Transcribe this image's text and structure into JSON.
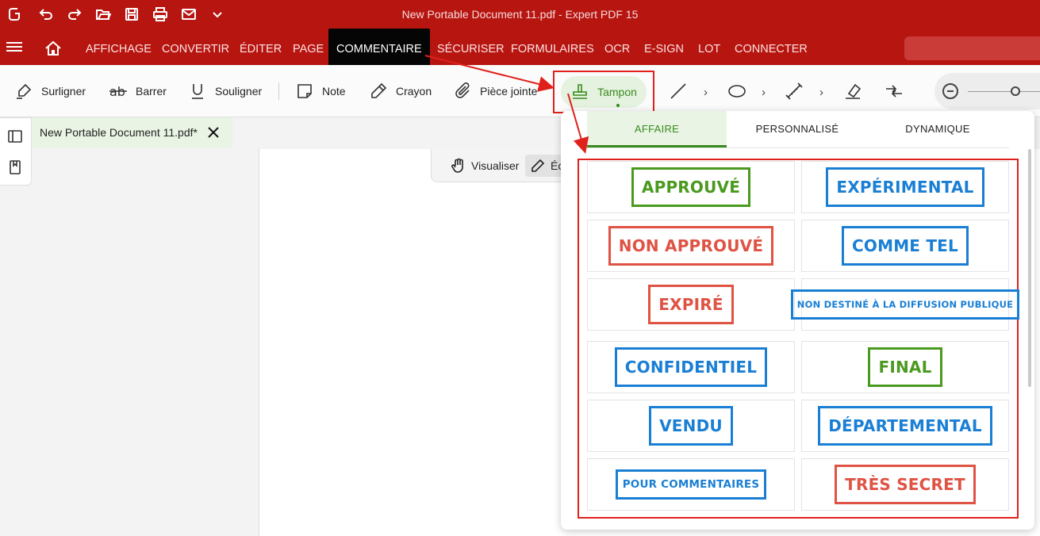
{
  "window": {
    "title": "New Portable Document 11.pdf   -   Expert PDF 15"
  },
  "quick_access": [
    "app-logo",
    "undo-icon",
    "redo-icon",
    "open-folder-icon",
    "save-icon",
    "print-icon",
    "mail-icon",
    "chevron-down-icon"
  ],
  "menu": {
    "items": [
      "AFFICHAGE",
      "CONVERTIR",
      "ÉDITER",
      "PAGE",
      "COMMENTAIRE",
      "SÉCURISER",
      "FORMULAIRES",
      "OCR",
      "E-SIGN",
      "LOT",
      "CONNECTER"
    ],
    "active": "COMMENTAIRE"
  },
  "toolbar": {
    "surligner": "Surligner",
    "barrer": "Barrer",
    "souligner": "Souligner",
    "note": "Note",
    "crayon": "Crayon",
    "piece_jointe": "Pièce jointe",
    "tampon": "Tampon"
  },
  "document_tab": {
    "name": "New Portable Document 11.pdf*"
  },
  "view_bar": {
    "visualiser": "Visualiser",
    "edit_partial": "Éc"
  },
  "stamp_panel": {
    "tabs": [
      "AFFAIRE",
      "PERSONNALISÉ",
      "DYNAMIQUE"
    ],
    "active_tab": "AFFAIRE",
    "stamps": [
      {
        "label": "APPROUVÉ",
        "color": "#4a9a1f"
      },
      {
        "label": "EXPÉRIMENTAL",
        "color": "#1a7fd4"
      },
      {
        "label": "NON APPROUVÉ",
        "color": "#df5344"
      },
      {
        "label": "COMME TEL",
        "color": "#1a7fd4"
      },
      {
        "label": "EXPIRÉ",
        "color": "#df5344"
      },
      {
        "label": "NON DESTINÉ À LA DIFFUSION PUBLIQUE",
        "color": "#1a7fd4"
      },
      {
        "label": "CONFIDENTIEL",
        "color": "#1a7fd4"
      },
      {
        "label": "FINAL",
        "color": "#4a9a1f"
      },
      {
        "label": "VENDU",
        "color": "#1a7fd4"
      },
      {
        "label": "DÉPARTEMENTAL",
        "color": "#1a7fd4"
      },
      {
        "label": "POUR COMMENTAIRES",
        "color": "#1a7fd4"
      },
      {
        "label": "TRÈS SECRET",
        "color": "#df5344"
      }
    ]
  },
  "colors": {
    "brand": "#b71510",
    "accent_green": "#3a8a1f",
    "annotation_red": "#e0201b"
  }
}
